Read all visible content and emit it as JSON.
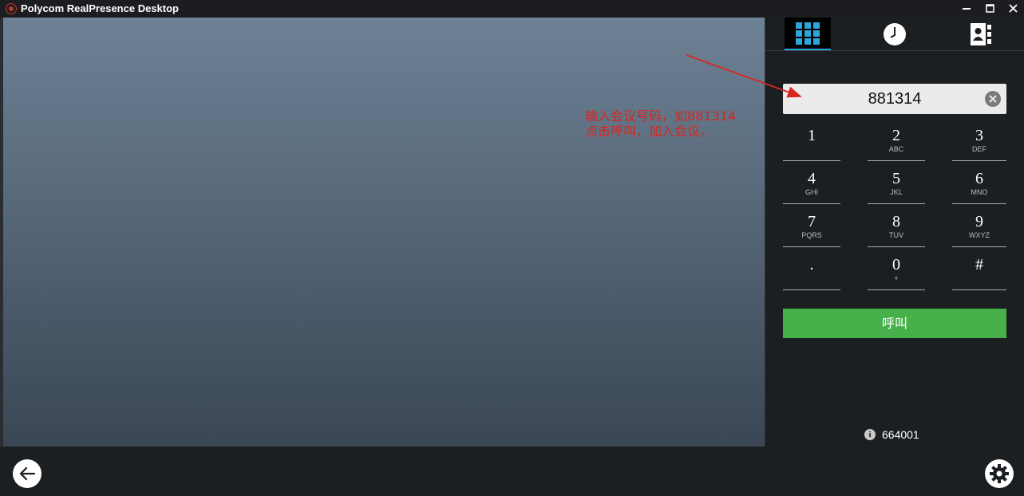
{
  "window": {
    "title": "Polycom RealPresence Desktop"
  },
  "tabs": [
    {
      "name": "dialpad",
      "icon": "dialpad-grid-icon",
      "active": true
    },
    {
      "name": "recent",
      "icon": "clock-icon",
      "active": false
    },
    {
      "name": "contacts",
      "icon": "contacts-book-icon",
      "active": false
    }
  ],
  "dialer": {
    "value": "881314"
  },
  "keypad": [
    {
      "digit": "1",
      "letters": ""
    },
    {
      "digit": "2",
      "letters": "ABC"
    },
    {
      "digit": "3",
      "letters": "DEF"
    },
    {
      "digit": "4",
      "letters": "GHI"
    },
    {
      "digit": "5",
      "letters": "JKL"
    },
    {
      "digit": "6",
      "letters": "MNO"
    },
    {
      "digit": "7",
      "letters": "PQRS"
    },
    {
      "digit": "8",
      "letters": "TUV"
    },
    {
      "digit": "9",
      "letters": "WXYZ"
    },
    {
      "digit": ".",
      "letters": ""
    },
    {
      "digit": "0",
      "letters": "+"
    },
    {
      "digit": "#",
      "letters": ""
    }
  ],
  "call_button": {
    "label": "呼叫"
  },
  "status": {
    "extension": "664001"
  },
  "annotation": {
    "line1": "输入会议号码，如881314",
    "line2": "点击呼叫，加入会议。"
  },
  "colors": {
    "accent": "#2aa8e0",
    "call": "#47b04b",
    "annotation": "#d8261f"
  }
}
